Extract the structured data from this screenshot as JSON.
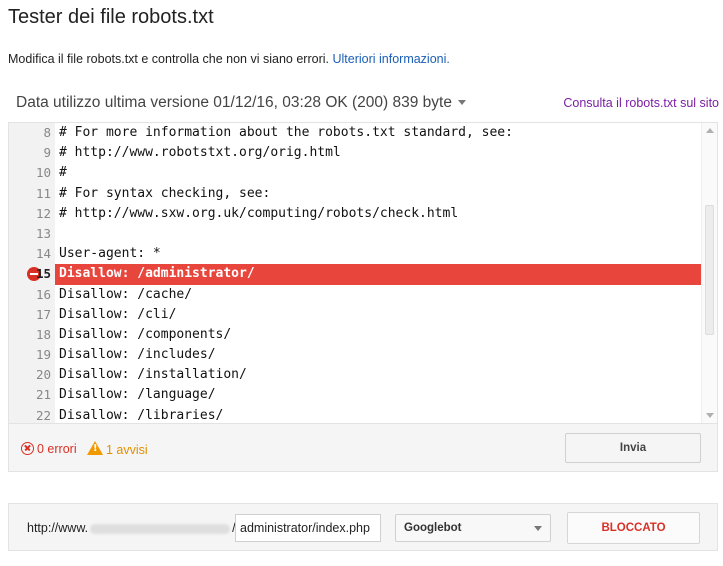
{
  "header": {
    "title": "Tester dei file robots.txt",
    "subtitle": "Modifica il file robots.txt e controlla che non vi siano errori.",
    "more_info_link": "Ulteriori informazioni."
  },
  "version": {
    "label": "Data utilizzo ultima versione 01/12/16, 03:28 OK (200) 839 byte",
    "live_link": "Consulta il robots.txt sul sito"
  },
  "editor": {
    "lines": [
      {
        "num": "8",
        "text": "# For more information about the robots.txt standard, see:"
      },
      {
        "num": "9",
        "text": "# http://www.robotstxt.org/orig.html"
      },
      {
        "num": "10",
        "text": "#"
      },
      {
        "num": "11",
        "text": "# For syntax checking, see:"
      },
      {
        "num": "12",
        "text": "# http://www.sxw.org.uk/computing/robots/check.html"
      },
      {
        "num": "13",
        "text": ""
      },
      {
        "num": "14",
        "text": "User-agent: *"
      },
      {
        "num": "15",
        "text": "Disallow: /administrator/"
      },
      {
        "num": "16",
        "text": "Disallow: /cache/"
      },
      {
        "num": "17",
        "text": "Disallow: /cli/"
      },
      {
        "num": "18",
        "text": "Disallow: /components/"
      },
      {
        "num": "19",
        "text": "Disallow: /includes/"
      },
      {
        "num": "20",
        "text": "Disallow: /installation/"
      },
      {
        "num": "21",
        "text": "Disallow: /language/"
      },
      {
        "num": "22",
        "text": "Disallow: /libraries/"
      }
    ],
    "error_line": "15",
    "error_color": "#e8453c"
  },
  "status": {
    "errors": "0 errori",
    "warnings": "1 avvisi",
    "submit_label": "Invia"
  },
  "test": {
    "url_prefix": "http://www.",
    "url_suffix": "/",
    "path_value": "administrator/index.php",
    "user_agent": "Googlebot",
    "result_label": "BLOCCATO",
    "result_color": "#d93025"
  }
}
